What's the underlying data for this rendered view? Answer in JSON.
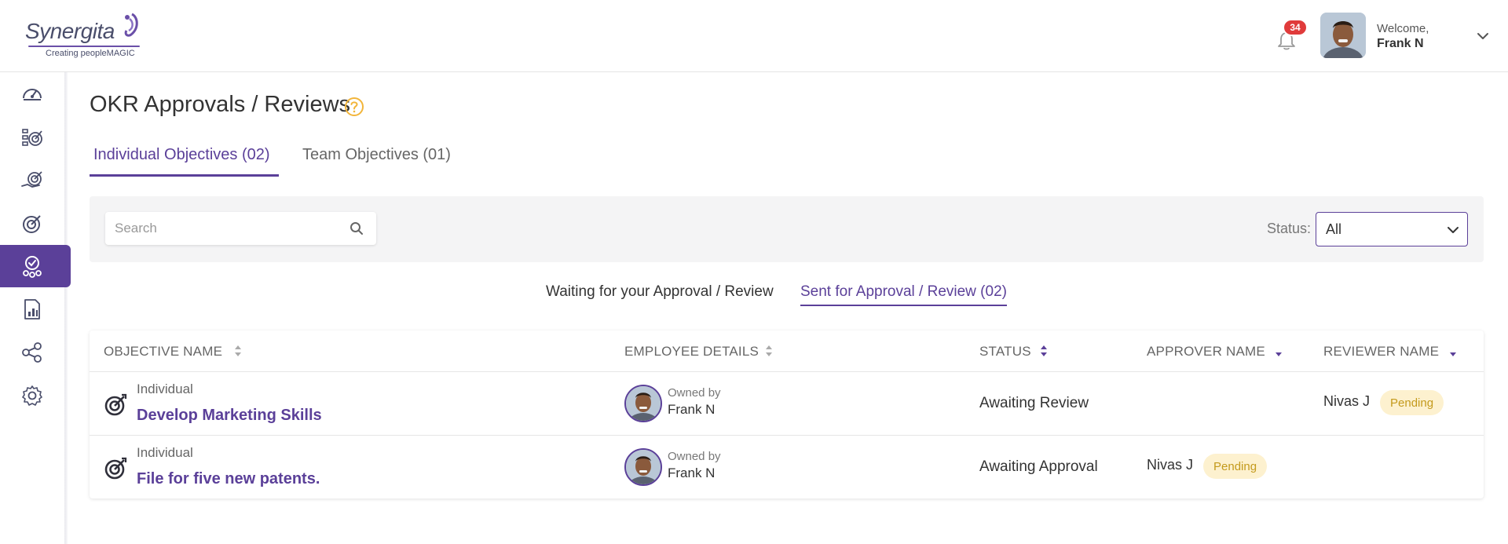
{
  "header": {
    "logo_text": "Synergita",
    "logo_tagline": "Creating peopleMAGIC",
    "notification_count": "34",
    "welcome_label": "Welcome,",
    "user_name": "Frank N"
  },
  "sidebar": {
    "items": [
      {
        "icon": "dashboard-icon",
        "active": false
      },
      {
        "icon": "checklist-target-icon",
        "active": false
      },
      {
        "icon": "hand-target-icon",
        "active": false
      },
      {
        "icon": "target-icon",
        "active": false
      },
      {
        "icon": "approval-badge-icon",
        "active": true
      },
      {
        "icon": "report-icon",
        "active": false
      },
      {
        "icon": "hierarchy-icon",
        "active": false
      },
      {
        "icon": "settings-icon",
        "active": false
      }
    ]
  },
  "page": {
    "title": "OKR Approvals / Reviews",
    "tabs": [
      {
        "label": "Individual Objectives (02)",
        "active": true
      },
      {
        "label": "Team Objectives (01)",
        "active": false
      }
    ]
  },
  "filters": {
    "search_placeholder": "Search",
    "status_label": "Status:",
    "status_value": "All"
  },
  "subtabs": [
    {
      "label": "Waiting for your Approval / Review",
      "active": false
    },
    {
      "label": "Sent for Approval / Review (02)",
      "active": true
    }
  ],
  "table": {
    "columns": [
      "OBJECTIVE NAME",
      "EMPLOYEE DETAILS",
      "STATUS",
      "APPROVER NAME",
      "REVIEWER NAME"
    ],
    "rows": [
      {
        "type": "Individual",
        "name": "Develop Marketing Skills",
        "owned_label": "Owned by",
        "owner": "Frank N",
        "status": "Awaiting Review",
        "approver": "",
        "approver_status": "",
        "reviewer": "Nivas J",
        "reviewer_status": "Pending"
      },
      {
        "type": "Individual",
        "name": "File for five new patents.",
        "owned_label": "Owned by",
        "owner": "Frank N",
        "status": "Awaiting Approval",
        "approver": "Nivas J",
        "approver_status": "Pending",
        "reviewer": "",
        "reviewer_status": ""
      }
    ]
  },
  "colors": {
    "brand_purple": "#5b4099",
    "notification_red": "#e03b3b",
    "pending_bg": "#fdf1cf",
    "pending_text": "#c49a1c",
    "help_orange": "#f2b53a"
  }
}
